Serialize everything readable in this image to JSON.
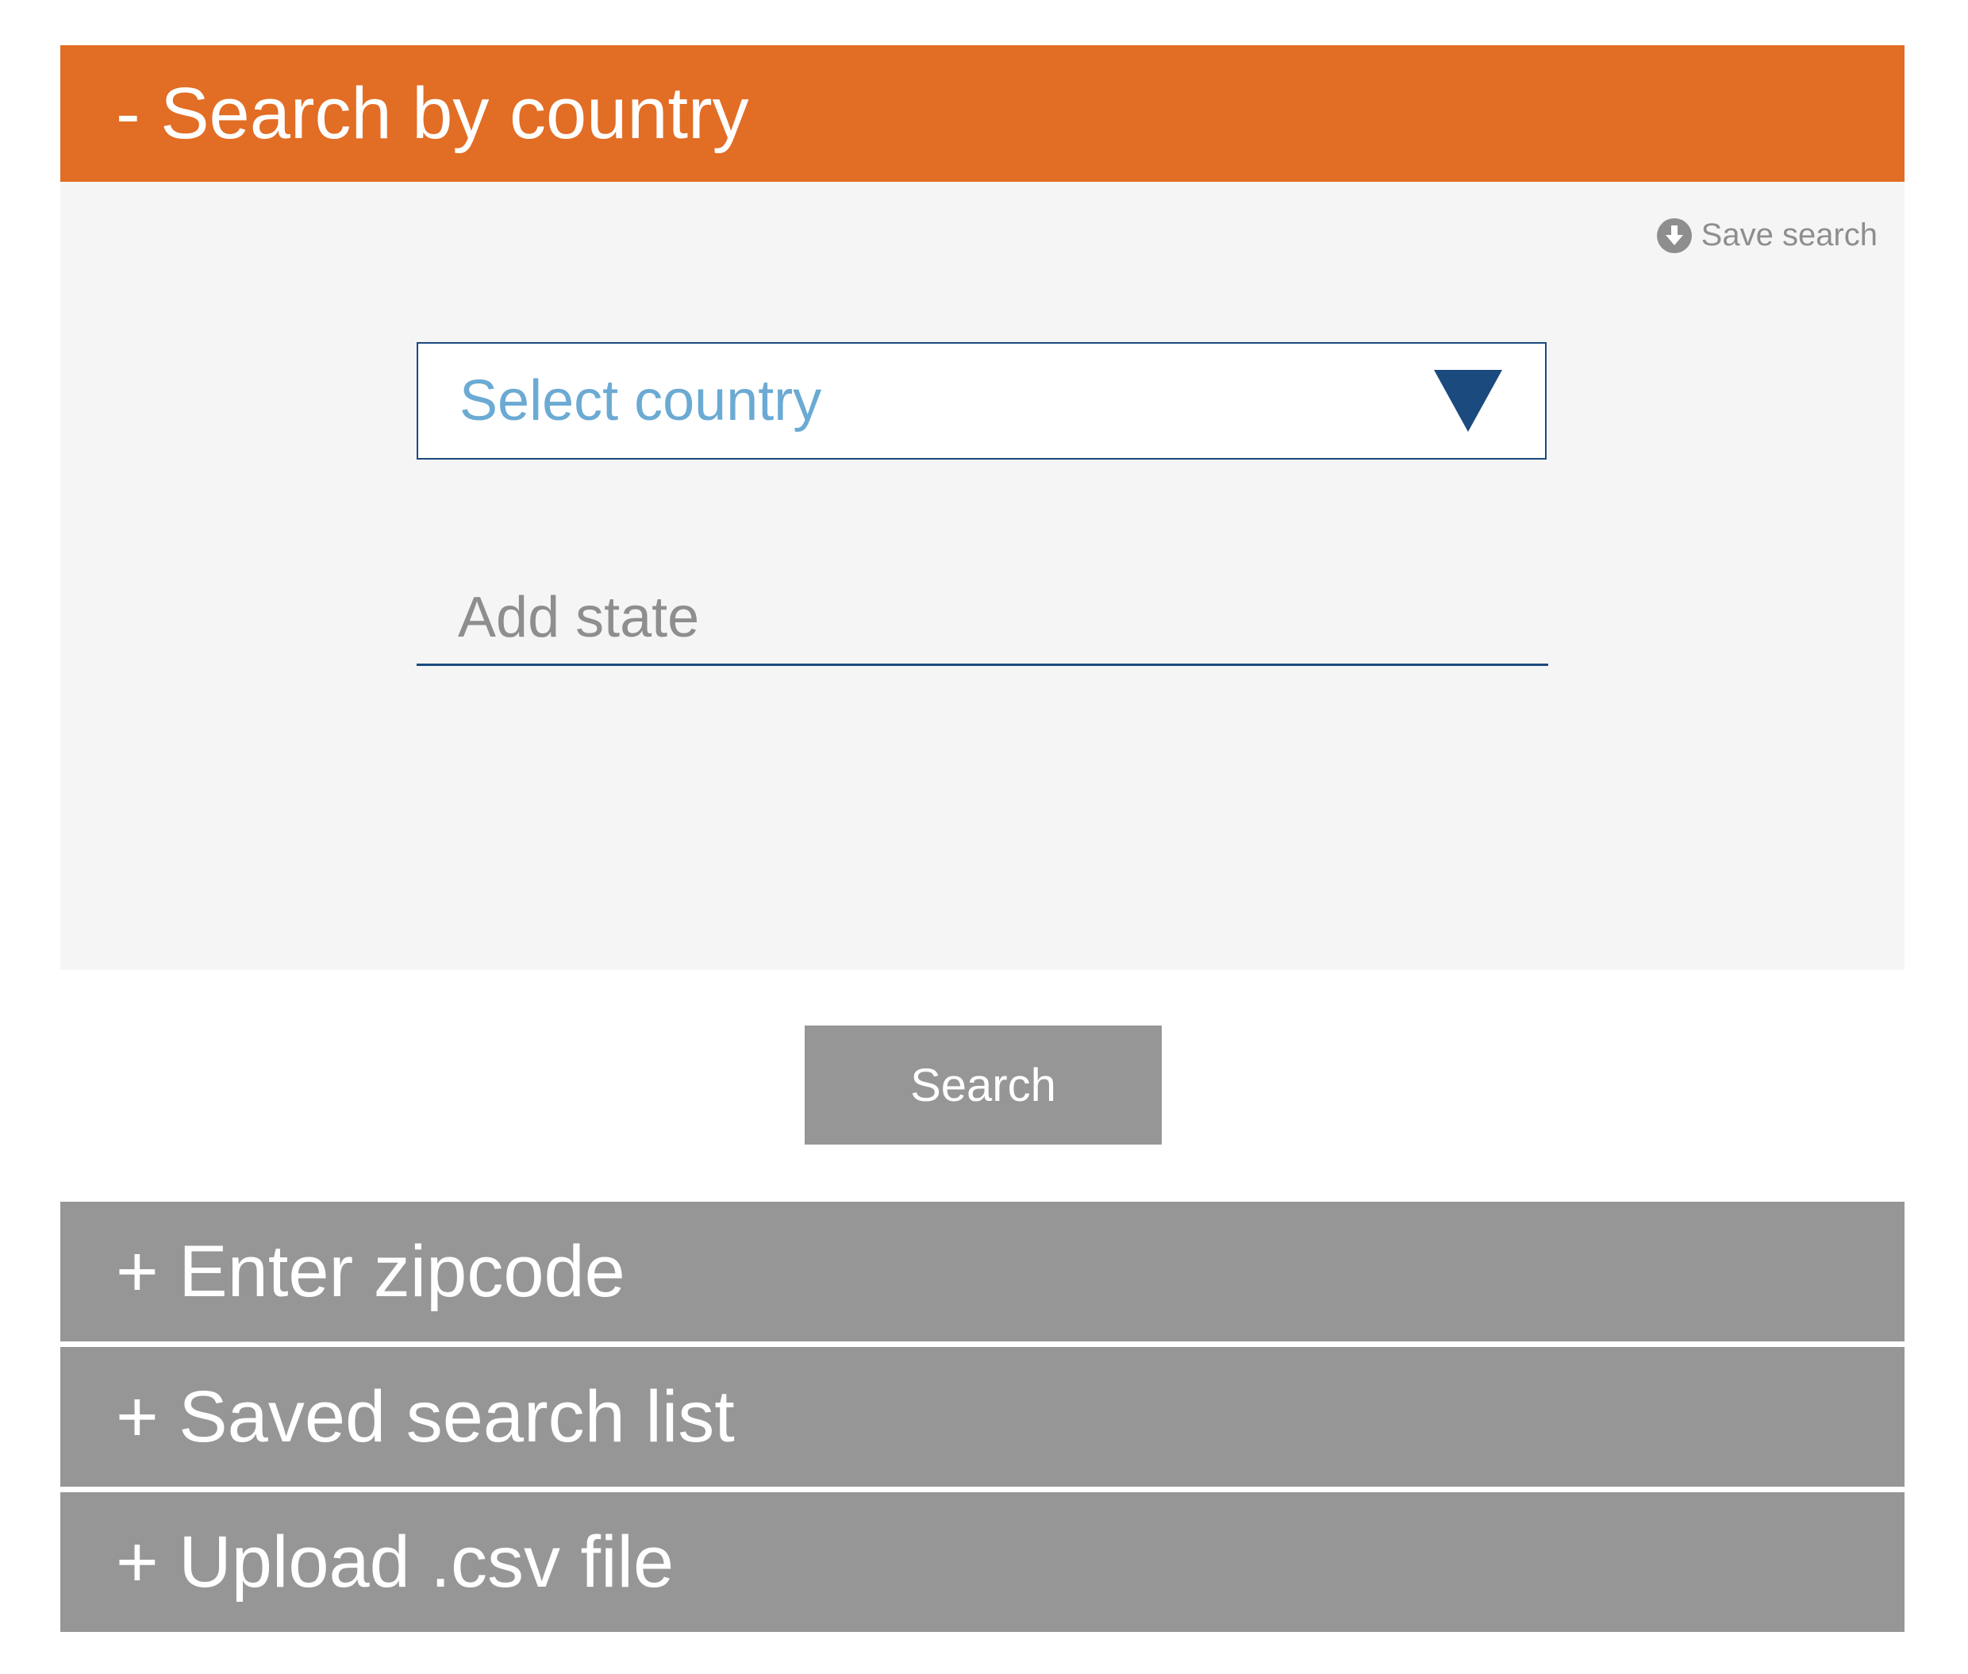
{
  "accordion": {
    "active": {
      "title": "- Search by country"
    },
    "panel": {
      "save_search_label": "Save search",
      "save_search_icon": "download-circle-icon",
      "country_select": {
        "value": "Select country",
        "icon": "triangle-down-icon"
      },
      "state_input": {
        "placeholder": "Add state",
        "value": ""
      }
    },
    "collapsed_items": [
      {
        "title": "+ Enter zipcode"
      },
      {
        "title": "+ Saved search list"
      },
      {
        "title": "+ Upload .csv file"
      }
    ]
  },
  "search_button": {
    "label": "Search"
  },
  "colors": {
    "active_header": "#E26D24",
    "collapsed_header": "#969696",
    "panel_background": "#F5F5F5",
    "accent_blue": "#1B4A7E",
    "placeholder_blue": "#6BAAD3",
    "muted_text": "#8E8E8E"
  }
}
